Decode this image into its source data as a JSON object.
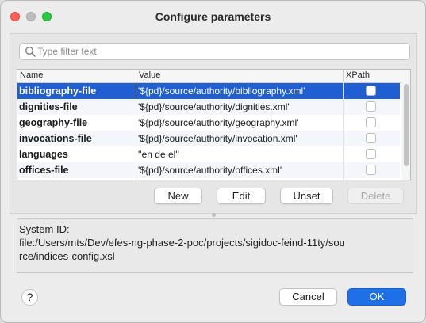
{
  "window": {
    "title": "Configure parameters"
  },
  "filter": {
    "placeholder": "Type filter text",
    "value": ""
  },
  "table": {
    "columns": [
      "Name",
      "Value",
      "XPath"
    ],
    "rows": [
      {
        "name": "bibliography-file",
        "value": "'${pd}/source/authority/bibliography.xml'",
        "xpath": false,
        "selected": true
      },
      {
        "name": "dignities-file",
        "value": "'${pd}/source/authority/dignities.xml'",
        "xpath": false,
        "selected": false
      },
      {
        "name": "geography-file",
        "value": "'${pd}/source/authority/geography.xml'",
        "xpath": false,
        "selected": false
      },
      {
        "name": "invocations-file",
        "value": "'${pd}/source/authority/invocation.xml'",
        "xpath": false,
        "selected": false
      },
      {
        "name": "languages",
        "value": "''en de el''",
        "xpath": false,
        "selected": false
      },
      {
        "name": "offices-file",
        "value": "'${pd}/source/authority/offices.xml'",
        "xpath": false,
        "selected": false
      }
    ]
  },
  "buttons": {
    "new": "New",
    "edit": "Edit",
    "unset": "Unset",
    "delete": "Delete"
  },
  "system_id": {
    "label": "System ID:",
    "line1": "file:/Users/mts/Dev/efes-ng-phase-2-poc/projects/sigidoc-feind-11ty/sou",
    "line2": "rce/indices-config.xsl"
  },
  "footer": {
    "help": "?",
    "cancel": "Cancel",
    "ok": "OK"
  },
  "colors": {
    "selection": "#1f5fd1",
    "ok_button": "#1f6fe7",
    "close": "#ff5f57",
    "maximize": "#28c840"
  }
}
